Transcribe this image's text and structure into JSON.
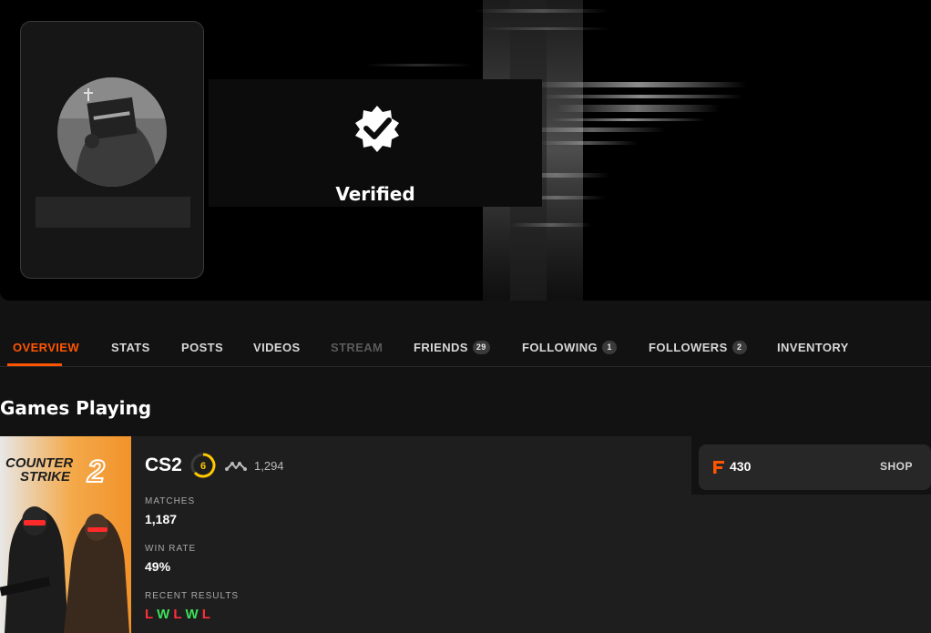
{
  "profile": {
    "verified_label": "Verified",
    "avatar_icon": "avatar-image"
  },
  "tabs": [
    {
      "label": "OVERVIEW",
      "state": "active"
    },
    {
      "label": "STATS"
    },
    {
      "label": "POSTS"
    },
    {
      "label": "VIDEOS"
    },
    {
      "label": "STREAM",
      "state": "disabled"
    },
    {
      "label": "FRIENDS",
      "count": "29"
    },
    {
      "label": "FOLLOWING",
      "count": "1"
    },
    {
      "label": "FOLLOWERS",
      "count": "2"
    },
    {
      "label": "INVENTORY"
    }
  ],
  "section_title": "Games Playing",
  "game": {
    "cover_title_line1": "COUNTER",
    "cover_title_line2": "STRIKE",
    "cover_number": "2",
    "name": "CS2",
    "level": "6",
    "elo": "1,294",
    "stats": [
      {
        "label": "MATCHES",
        "value": "1,187"
      },
      {
        "label": "WIN RATE",
        "value": "49%"
      },
      {
        "label": "RECENT RESULTS",
        "value": ""
      }
    ],
    "recent_results": [
      "L",
      "W",
      "L",
      "W",
      "L"
    ]
  },
  "shop": {
    "points": "430",
    "button_label": "SHOP"
  },
  "colors": {
    "accent": "#ff5500",
    "win": "#3ee05a",
    "loss": "#ff2f3a",
    "level": "#ffc800"
  }
}
